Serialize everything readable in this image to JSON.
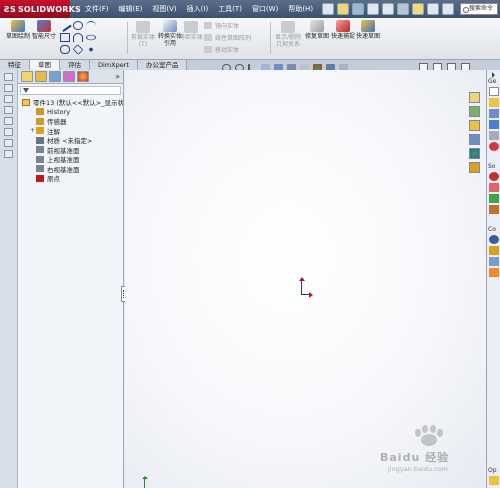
{
  "app": {
    "logo_text": "SOLIDWORKS"
  },
  "menu": [
    "文件(F)",
    "编辑(E)",
    "视图(V)",
    "插入(I)",
    "工具(T)",
    "窗口(W)",
    "帮助(H)"
  ],
  "search": {
    "placeholder": "搜索命令"
  },
  "ribbon": {
    "sketch": "草图绘制",
    "smart_dim": "智能尺寸",
    "trim": "剪裁实体(T)",
    "convert": "转换实体引用",
    "offset": "等距实体",
    "mirror": "镜向实体",
    "linear_pattern": "线性草图阵列",
    "move": "移动实体",
    "display_delete": "显示/删除几何关系",
    "repair": "修复草图",
    "quick_snap": "快速捕捉",
    "rapid_sketch": "快速草图"
  },
  "tabs": [
    "特征",
    "草图",
    "评估",
    "DimXpert",
    "办公室产品"
  ],
  "tree": {
    "root": "零件13 (默认<<默认>_显示状态",
    "items": [
      {
        "label": "History",
        "color": "#c89b2a"
      },
      {
        "label": "传感器",
        "color": "#c89b2a"
      },
      {
        "label": "注解",
        "color": "#d9a21b",
        "expand": "+"
      },
      {
        "label": "材质 <未指定>",
        "color": "#6a7480"
      },
      {
        "label": "前视基准面",
        "color": "#7a8592"
      },
      {
        "label": "上视基准面",
        "color": "#7a8592"
      },
      {
        "label": "右视基准面",
        "color": "#7a8592"
      },
      {
        "label": "原点",
        "color": "#c01818"
      }
    ]
  },
  "taskpane": {
    "labels": [
      "Ge",
      "So",
      "Co",
      "Op"
    ]
  },
  "watermark": {
    "brand": "Baidu 经验",
    "url": "jingyan.baidu.com"
  }
}
